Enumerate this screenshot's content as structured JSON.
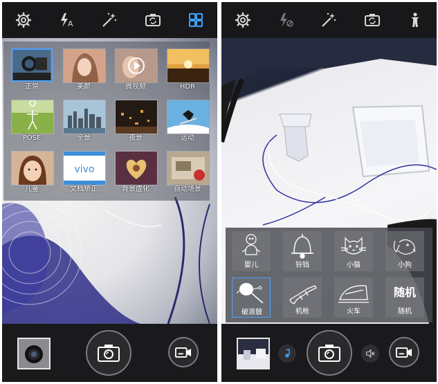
{
  "left_screen": {
    "toolbar": {
      "icons": [
        "settings-icon",
        "flash-auto-icon",
        "magic-wand-icon",
        "switch-camera-icon",
        "modes-grid-icon"
      ],
      "flash_label": "A",
      "active_color": "#3fa0ff"
    },
    "modes": [
      {
        "label": "正常",
        "selected": true
      },
      {
        "label": "美颜"
      },
      {
        "label": "微视频"
      },
      {
        "label": "HDR"
      },
      {
        "label": "POSE"
      },
      {
        "label": "全景"
      },
      {
        "label": "夜景"
      },
      {
        "label": "运动"
      },
      {
        "label": "儿童"
      },
      {
        "label": "文档矫正"
      },
      {
        "label": "背景虚化"
      },
      {
        "label": "自动场景"
      }
    ],
    "doc_logo_text": "vivo",
    "bottom": {
      "shutter": "camera-shutter",
      "video": "video-record"
    }
  },
  "right_screen": {
    "toolbar": {
      "icons": [
        "settings-icon",
        "flash-off-icon",
        "magic-wand-icon",
        "switch-camera-icon",
        "person-pose-icon"
      ]
    },
    "sounds": [
      {
        "label": "婴儿",
        "icon": "baby-icon"
      },
      {
        "label": "铃铛",
        "icon": "bell-icon"
      },
      {
        "label": "小猫",
        "icon": "cat-icon"
      },
      {
        "label": "小狗",
        "icon": "dog-icon"
      },
      {
        "label": "破浪鼓",
        "icon": "rattle-drum-icon",
        "selected": true
      },
      {
        "label": "机枪",
        "icon": "machine-gun-icon"
      },
      {
        "label": "火车",
        "icon": "train-icon"
      },
      {
        "label": "随机",
        "icon": "random-icon",
        "big_text": "随机"
      }
    ]
  }
}
